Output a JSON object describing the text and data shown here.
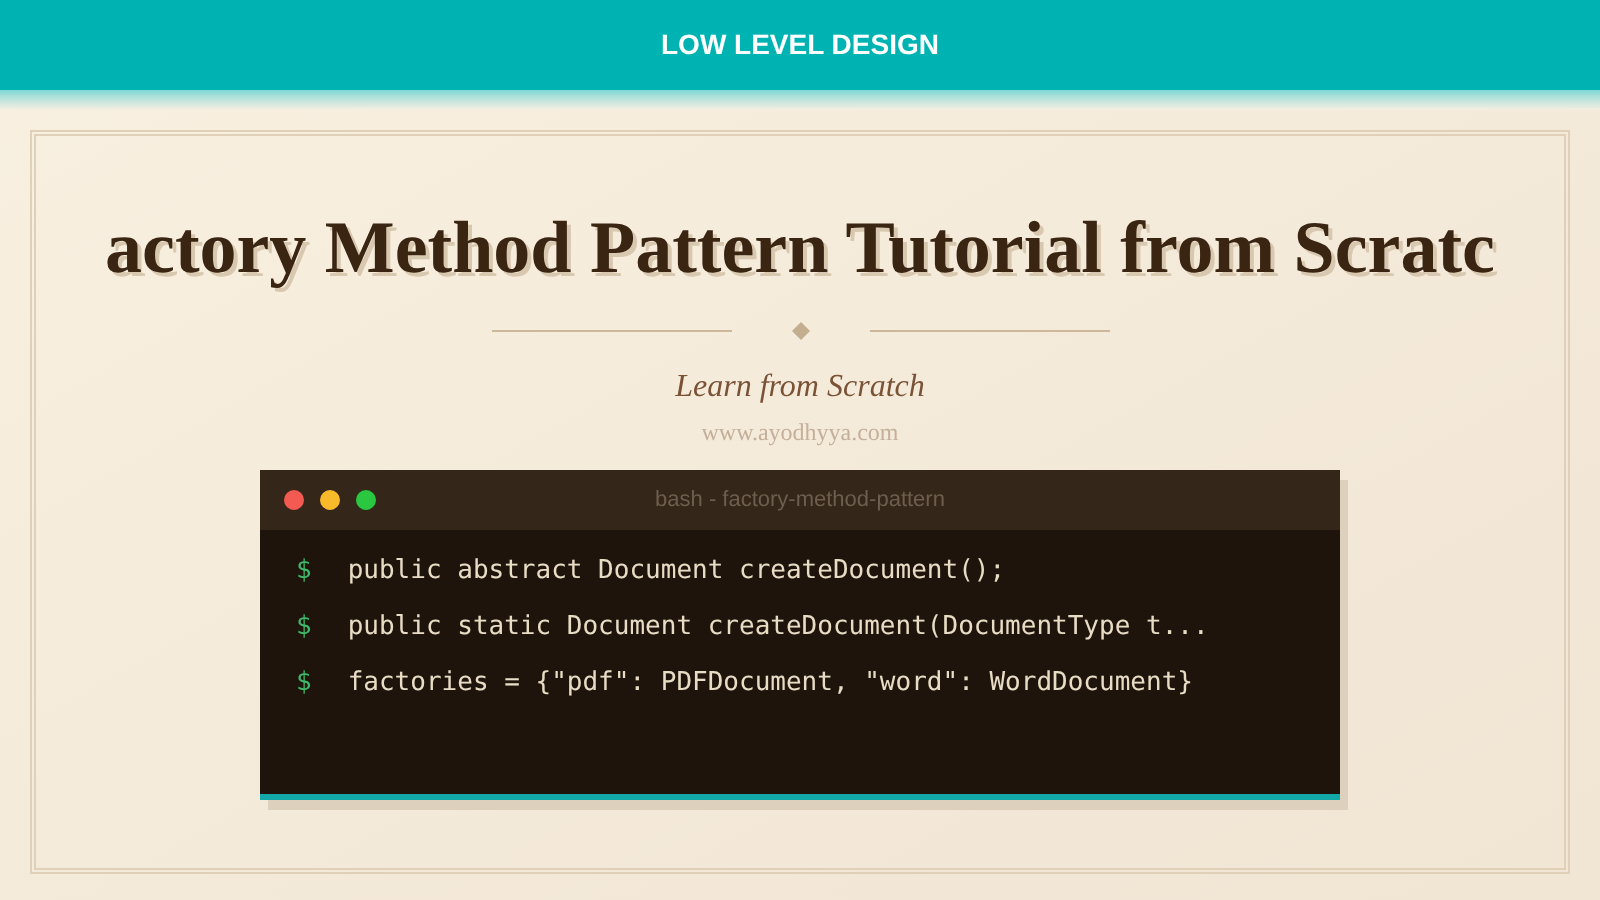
{
  "header": {
    "title": "LOW LEVEL DESIGN"
  },
  "hero": {
    "title": "actory Method Pattern Tutorial from Scratc",
    "subtitle": "Learn from Scratch",
    "site": "www.ayodhyya.com"
  },
  "terminal": {
    "title": "bash - factory-method-pattern",
    "lines": [
      {
        "prompt": "$",
        "code": "public abstract Document createDocument();"
      },
      {
        "prompt": "$",
        "code": "public static Document createDocument(DocumentType t..."
      },
      {
        "prompt": "$",
        "code": "factories = {\"pdf\": PDFDocument, \"word\": WordDocument}"
      }
    ]
  }
}
